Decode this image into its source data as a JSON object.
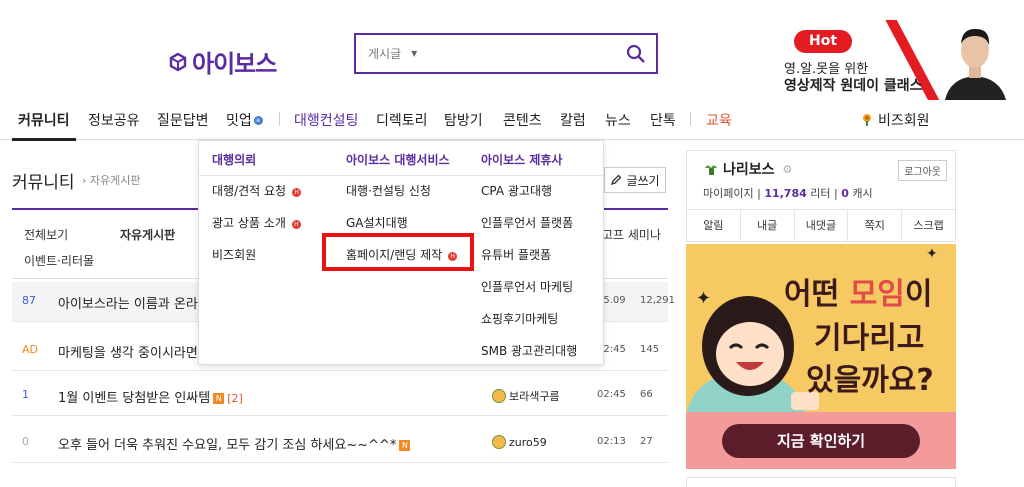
{
  "header": {
    "logo_text": "아이보스",
    "search": {
      "scope": "게시글"
    },
    "ad": {
      "hot": "Hot",
      "line1": "영.알.못을 위한",
      "line2": "영상제작 원데이 클래스"
    }
  },
  "nav": {
    "items": [
      "커뮤니티",
      "정보공유",
      "질문답변",
      "밋업",
      "대행컨설팅",
      "디렉토리",
      "탐방기",
      "콘텐츠",
      "칼럼",
      "뉴스",
      "단톡",
      "교육"
    ],
    "badge_e": "e",
    "biz": "비즈회원"
  },
  "board": {
    "title": "커뮤니티",
    "crumb": "자유게시판",
    "write": "글쓰기",
    "subtabs": [
      "전체보기",
      "자유게시판",
      "이벤트·리터몰"
    ],
    "seminar": "고프 세미나",
    "rows": [
      {
        "num": "87",
        "title": "아이보스라는 이름과 온라",
        "author": "",
        "time": "05.09",
        "views": "12,291",
        "hl": true
      },
      {
        "num": "AD",
        "title": "마케팅을 생각 중이시라면",
        "author": "",
        "time": "02:45",
        "views": "145"
      },
      {
        "num": "1",
        "title": "1월 이벤트 당첨받은 인싸템",
        "n": "N",
        "comments": "[2]",
        "author": "보라색구름",
        "time": "02:45",
        "views": "66"
      },
      {
        "num": "0",
        "title": "오후 들어 더욱 추워진 수요일, 모두 감기 조심 하세요~~^^*",
        "n": "N",
        "author": "zuro59",
        "time": "02:13",
        "views": "27"
      }
    ]
  },
  "dropdown": {
    "col1": {
      "head": "대행의뢰",
      "items": [
        "대행/견적 요청",
        "광고 상품 소개",
        "비즈회원"
      ]
    },
    "col2": {
      "head": "아이보스 대행서비스",
      "items": [
        "대행·컨설팅 신청",
        "GA설치대행",
        "홈페이지/랜딩 제작"
      ]
    },
    "col3": {
      "head": "아이보스 제휴사",
      "items": [
        "CPA 광고대행",
        "인플루언서 플랫폼",
        "유튜버 플랫폼",
        "인플루언서 마케팅",
        "쇼핑후기마케팅",
        "SMB 광고관리대행"
      ]
    },
    "hot_badge": "H"
  },
  "profile": {
    "name": "나리보스",
    "logout": "로그아웃",
    "mypage": "마이페이지",
    "liter": "11,784",
    "liter_unit": "리터",
    "cash": "0",
    "cash_unit": "캐시",
    "tabs": [
      "알림",
      "내글",
      "내댓글",
      "쪽지",
      "스크랩"
    ]
  },
  "banner": {
    "line1a": "어떤 ",
    "line1b": "모임",
    "line1c": "이",
    "line2": "기다리고",
    "line3": "있을까요?",
    "cta": "지금 확인하기"
  },
  "colors": {
    "brand": "#5a2ca0",
    "hot": "#e31b23",
    "highlight_box": "#ee1111"
  }
}
